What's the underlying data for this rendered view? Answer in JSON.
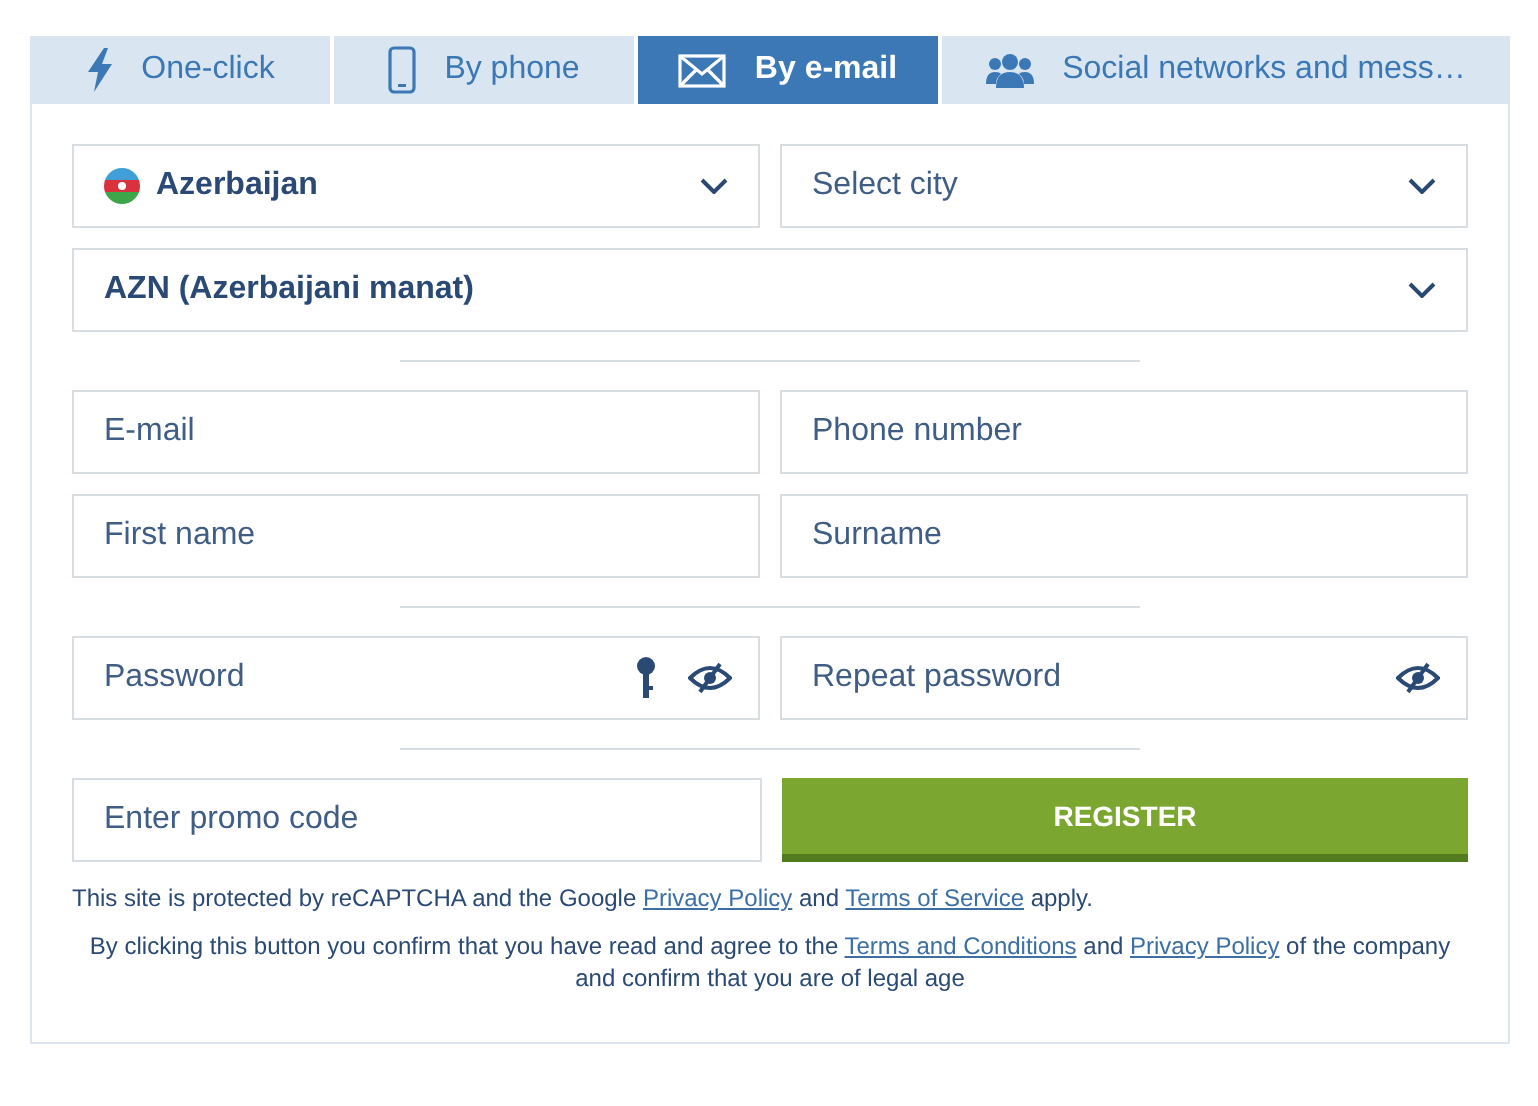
{
  "tabs": [
    {
      "label": "One-click",
      "kind": "oneclick",
      "selected": false
    },
    {
      "label": "By phone",
      "kind": "phone",
      "selected": false
    },
    {
      "label": "By e-mail",
      "kind": "email",
      "selected": true
    },
    {
      "label": "Social networks and mess…",
      "kind": "social",
      "selected": false
    }
  ],
  "country": {
    "value": "Azerbaijan"
  },
  "city": {
    "placeholder": "Select city"
  },
  "currency": {
    "value": "AZN (Azerbaijani manat)"
  },
  "email": {
    "placeholder": "E-mail"
  },
  "phone": {
    "placeholder": "Phone number"
  },
  "first_name": {
    "placeholder": "First name"
  },
  "surname": {
    "placeholder": "Surname"
  },
  "password": {
    "placeholder": "Password"
  },
  "repeat_password": {
    "placeholder": "Repeat password"
  },
  "promo": {
    "placeholder": "Enter promo code"
  },
  "register_button": "REGISTER",
  "recaptcha_note": [
    {
      "kind": "text",
      "text": "This site is protected by reCAPTCHA and the Google "
    },
    {
      "kind": "link",
      "text": "Privacy Policy"
    },
    {
      "kind": "text",
      "text": " and "
    },
    {
      "kind": "link",
      "text": "Terms of Service"
    },
    {
      "kind": "text",
      "text": " apply."
    }
  ],
  "consent_note": [
    {
      "kind": "text",
      "text": "By clicking this button you confirm that you have read and agree to the "
    },
    {
      "kind": "link",
      "text": "Terms and Conditions"
    },
    {
      "kind": "text",
      "text": " and "
    },
    {
      "kind": "link",
      "text": "Privacy Policy"
    },
    {
      "kind": "text",
      "text": " of the company and confirm that you are of legal age"
    }
  ]
}
